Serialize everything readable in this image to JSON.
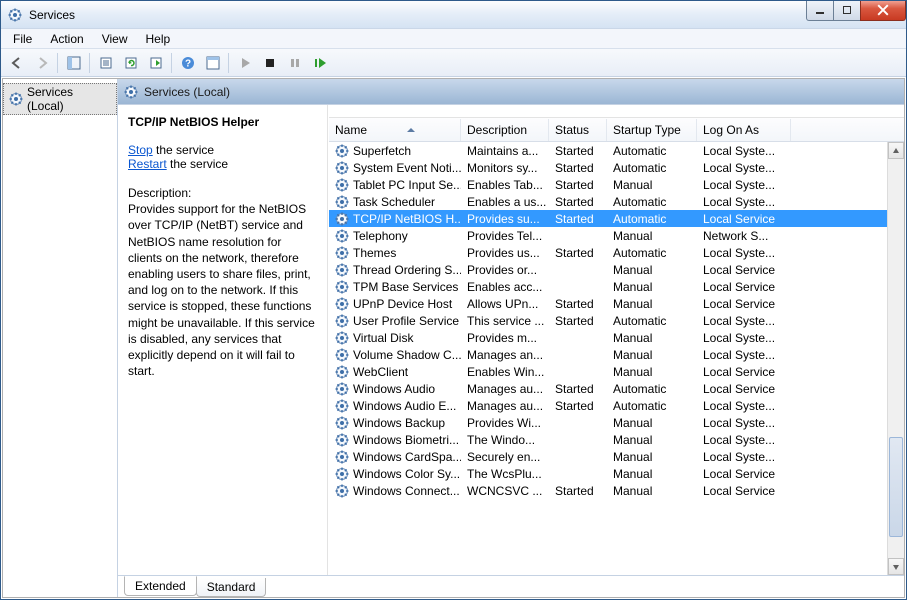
{
  "window": {
    "title": "Services"
  },
  "menu": [
    "File",
    "Action",
    "View",
    "Help"
  ],
  "tree": {
    "root_label": "Services (Local)"
  },
  "pane": {
    "header": "Services (Local)"
  },
  "detail": {
    "title": "TCP/IP NetBIOS Helper",
    "stop_link": "Stop",
    "stop_suffix": " the service",
    "restart_link": "Restart",
    "restart_suffix": " the service",
    "desc_label": "Description:",
    "desc_body": "Provides support for the NetBIOS over TCP/IP (NetBT) service and NetBIOS name resolution for clients on the network, therefore enabling users to share files, print, and log on to the network. If this service is stopped, these functions might be unavailable. If this service is disabled, any services that explicitly depend on it will fail to start."
  },
  "columns": {
    "name": "Name",
    "desc": "Description",
    "status": "Status",
    "startup": "Startup Type",
    "logon": "Log On As"
  },
  "rows": [
    {
      "name": "Superfetch",
      "desc": "Maintains a...",
      "status": "Started",
      "startup": "Automatic",
      "logon": "Local Syste..."
    },
    {
      "name": "System Event Noti...",
      "desc": "Monitors sy...",
      "status": "Started",
      "startup": "Automatic",
      "logon": "Local Syste..."
    },
    {
      "name": "Tablet PC Input Se...",
      "desc": "Enables Tab...",
      "status": "Started",
      "startup": "Manual",
      "logon": "Local Syste..."
    },
    {
      "name": "Task Scheduler",
      "desc": "Enables a us...",
      "status": "Started",
      "startup": "Automatic",
      "logon": "Local Syste..."
    },
    {
      "name": "TCP/IP NetBIOS H...",
      "desc": "Provides su...",
      "status": "Started",
      "startup": "Automatic",
      "logon": "Local Service",
      "selected": true
    },
    {
      "name": "Telephony",
      "desc": "Provides Tel...",
      "status": "",
      "startup": "Manual",
      "logon": "Network S..."
    },
    {
      "name": "Themes",
      "desc": "Provides us...",
      "status": "Started",
      "startup": "Automatic",
      "logon": "Local Syste..."
    },
    {
      "name": "Thread Ordering S...",
      "desc": "Provides or...",
      "status": "",
      "startup": "Manual",
      "logon": "Local Service"
    },
    {
      "name": "TPM Base Services",
      "desc": "Enables acc...",
      "status": "",
      "startup": "Manual",
      "logon": "Local Service"
    },
    {
      "name": "UPnP Device Host",
      "desc": "Allows UPn...",
      "status": "Started",
      "startup": "Manual",
      "logon": "Local Service"
    },
    {
      "name": "User Profile Service",
      "desc": "This service ...",
      "status": "Started",
      "startup": "Automatic",
      "logon": "Local Syste..."
    },
    {
      "name": "Virtual Disk",
      "desc": "Provides m...",
      "status": "",
      "startup": "Manual",
      "logon": "Local Syste..."
    },
    {
      "name": "Volume Shadow C...",
      "desc": "Manages an...",
      "status": "",
      "startup": "Manual",
      "logon": "Local Syste..."
    },
    {
      "name": "WebClient",
      "desc": "Enables Win...",
      "status": "",
      "startup": "Manual",
      "logon": "Local Service"
    },
    {
      "name": "Windows Audio",
      "desc": "Manages au...",
      "status": "Started",
      "startup": "Automatic",
      "logon": "Local Service"
    },
    {
      "name": "Windows Audio E...",
      "desc": "Manages au...",
      "status": "Started",
      "startup": "Automatic",
      "logon": "Local Syste..."
    },
    {
      "name": "Windows Backup",
      "desc": "Provides Wi...",
      "status": "",
      "startup": "Manual",
      "logon": "Local Syste..."
    },
    {
      "name": "Windows Biometri...",
      "desc": "The Windo...",
      "status": "",
      "startup": "Manual",
      "logon": "Local Syste..."
    },
    {
      "name": "Windows CardSpa...",
      "desc": "Securely en...",
      "status": "",
      "startup": "Manual",
      "logon": "Local Syste..."
    },
    {
      "name": "Windows Color Sy...",
      "desc": "The WcsPlu...",
      "status": "",
      "startup": "Manual",
      "logon": "Local Service"
    },
    {
      "name": "Windows Connect...",
      "desc": "WCNCSVC ...",
      "status": "Started",
      "startup": "Manual",
      "logon": "Local Service"
    }
  ],
  "tabs": {
    "extended": "Extended",
    "standard": "Standard"
  }
}
